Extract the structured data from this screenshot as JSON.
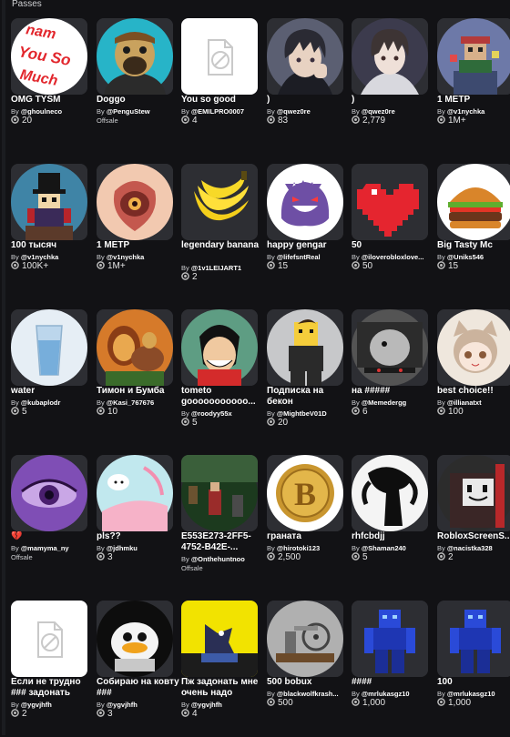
{
  "header": {
    "title": "Passes"
  },
  "by_prefix": "By",
  "offsale_label": "Offsale",
  "rows": [
    [
      {
        "title": "OMG TYSM",
        "creator": "@ghoulneco",
        "count": "20",
        "art": "tysm"
      },
      {
        "title": "Doggo",
        "creator": "@PenguStew",
        "offsale": true,
        "art": "doggo"
      },
      {
        "title": "You so good",
        "creator": "@EMILPRO0007",
        "count": "4",
        "art": "placeholder"
      },
      {
        "title": ")",
        "creator": "@qwez0re",
        "count": "83",
        "art": "anime1"
      },
      {
        "title": ")",
        "creator": "@qwez0re",
        "count": "2,779",
        "art": "anime2"
      },
      {
        "title": "1 МЕТР",
        "creator": "@v1nychka",
        "count": "1M+",
        "art": "pixel"
      }
    ],
    [
      {
        "title": "100 тысяч",
        "creator": "@v1nychka",
        "count": "100K+",
        "art": "tophat"
      },
      {
        "title": "1 МЕТР",
        "creator": "@v1nychka",
        "count": "1M+",
        "art": "hands"
      },
      {
        "title": "legendary banana",
        "creator": "@1v1LEIJART1",
        "count": "2",
        "art": "banana",
        "wrap": true
      },
      {
        "title": "happy gengar",
        "creator": "@lifefsntReal",
        "count": "15",
        "art": "gengar"
      },
      {
        "title": "50",
        "creator": "@iloverobloxlove...",
        "count": "50",
        "art": "heart"
      },
      {
        "title": "Big Tasty Mc",
        "creator": "@Uniks546",
        "count": "15",
        "art": "burger"
      }
    ],
    [
      {
        "title": "water",
        "creator": "@kubaplodr",
        "count": "5",
        "art": "water"
      },
      {
        "title": "Тимон и Бумба",
        "creator": "@Kasi_767676",
        "count": "10",
        "art": "lionking"
      },
      {
        "title": "tometo gooooooooooo...",
        "creator": "@roodyy55x",
        "count": "5",
        "art": "luffy",
        "wrap": true
      },
      {
        "title": "Подписка на бекон",
        "creator": "@MightbeV01D",
        "count": "20",
        "art": "bacon",
        "wrap": true
      },
      {
        "title": "на #####",
        "creator": "@Memedergg",
        "count": "6",
        "art": "meme"
      },
      {
        "title": "best choice!!",
        "creator": "@illianatxt",
        "count": "100",
        "art": "catgirl"
      }
    ],
    [
      {
        "title": "💔",
        "creator": "@mamyma_ny",
        "offsale": true,
        "art": "eye"
      },
      {
        "title": "pls??",
        "creator": "@jdhmku",
        "count": "3",
        "art": "kitty"
      },
      {
        "title": "E553E273-2FF5-4752-B42E-...",
        "creator": "@Onthehuntnoo",
        "offsale": true,
        "art": "game",
        "wrap": true
      },
      {
        "title": "граната",
        "creator": "@hirotoki123",
        "count": "2,500",
        "art": "coin"
      },
      {
        "title": "rhfcbdjj",
        "creator": "@Shaman240",
        "count": "5",
        "art": "shadow"
      },
      {
        "title": "RobloxScreenS...",
        "creator": "@nacistka328",
        "count": "2",
        "art": "robloxface"
      }
    ],
    [
      {
        "title": "Если не трудно ### задонать",
        "creator": "@ygvjhfh",
        "count": "2",
        "art": "placeholder",
        "wrap": true
      },
      {
        "title": "Собираю на ковту ###",
        "creator": "@ygvjhfh",
        "count": "3",
        "art": "duck",
        "wrap": true
      },
      {
        "title": "Пж задонать мне очень надо",
        "creator": "@ygvjhfh",
        "count": "4",
        "art": "crow",
        "wrap": true
      },
      {
        "title": "500 bobux",
        "creator": "@blackwolfkrash...",
        "count": "500",
        "art": "engine"
      },
      {
        "title": "####",
        "creator": "@mrlukasgz10",
        "count": "1,000",
        "art": "bluebot"
      },
      {
        "title": "100",
        "creator": "@mrlukasgz10",
        "count": "1,000",
        "art": "bluebot"
      }
    ]
  ]
}
